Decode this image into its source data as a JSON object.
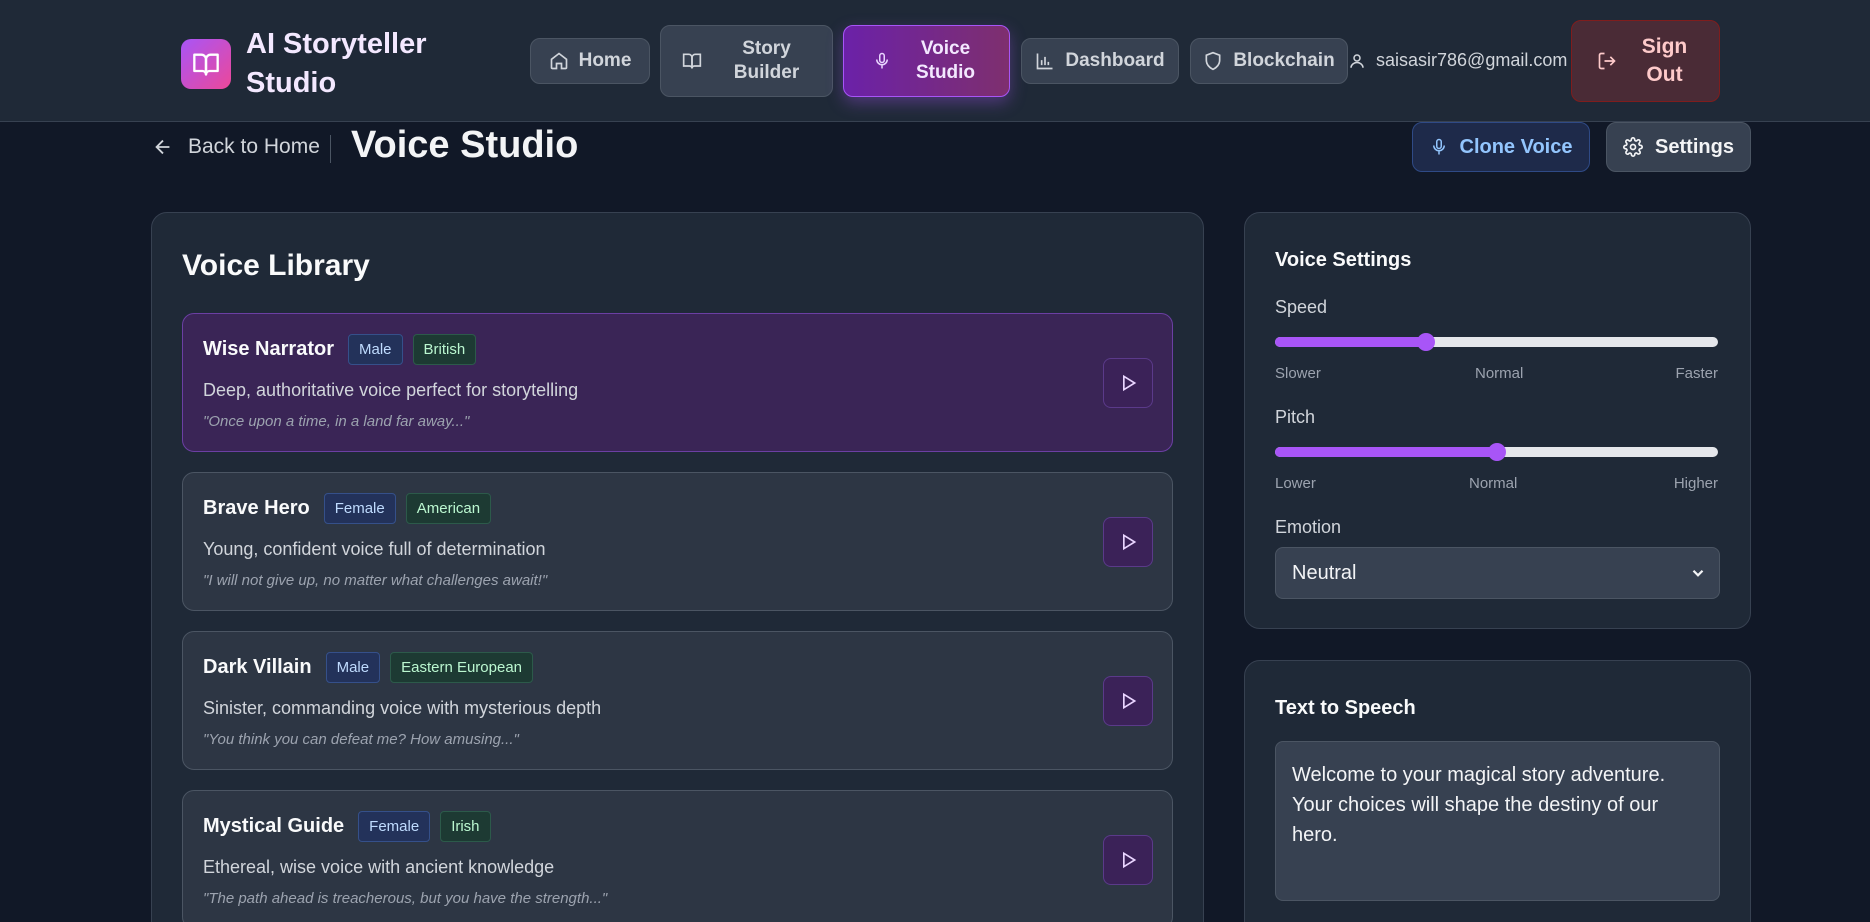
{
  "header": {
    "brand_title": "AI Storyteller Studio",
    "nav": {
      "home": "Home",
      "story_builder": "Story Builder",
      "voice_studio": "Voice Studio",
      "dashboard": "Dashboard",
      "blockchain": "Blockchain"
    },
    "user_email": "saisasir786@gmail.com",
    "sign_out": "Sign Out"
  },
  "subheader": {
    "back_label": "Back to Home",
    "page_title": "Voice Studio",
    "clone_voice": "Clone Voice",
    "settings": "Settings"
  },
  "library": {
    "title": "Voice Library",
    "voices": [
      {
        "name": "Wise Narrator",
        "gender": "Male",
        "accent": "British",
        "description": "Deep, authoritative voice perfect for storytelling",
        "sample": "\"Once upon a time, in a land far away...\"",
        "selected": true
      },
      {
        "name": "Brave Hero",
        "gender": "Female",
        "accent": "American",
        "description": "Young, confident voice full of determination",
        "sample": "\"I will not give up, no matter what challenges await!\"",
        "selected": false
      },
      {
        "name": "Dark Villain",
        "gender": "Male",
        "accent": "Eastern European",
        "description": "Sinister, commanding voice with mysterious depth",
        "sample": "\"You think you can defeat me? How amusing...\"",
        "selected": false
      },
      {
        "name": "Mystical Guide",
        "gender": "Female",
        "accent": "Irish",
        "description": "Ethereal, wise voice with ancient knowledge",
        "sample": "\"The path ahead is treacherous, but you have the strength...\"",
        "selected": false
      }
    ]
  },
  "voice_settings": {
    "title": "Voice Settings",
    "speed": {
      "label": "Speed",
      "value_fraction": 0.34,
      "min_label": "Slower",
      "mid_label": "Normal",
      "max_label": "Faster"
    },
    "pitch": {
      "label": "Pitch",
      "value_fraction": 0.5,
      "min_label": "Lower",
      "mid_label": "Normal",
      "max_label": "Higher"
    },
    "emotion": {
      "label": "Emotion",
      "selected": "Neutral"
    }
  },
  "tts": {
    "title": "Text to Speech",
    "text": "Welcome to your magical story adventure. Your choices will shape the destiny of our hero."
  },
  "colors": {
    "accent": "#a855f7",
    "background": "#111827",
    "panel": "#1f2937"
  }
}
